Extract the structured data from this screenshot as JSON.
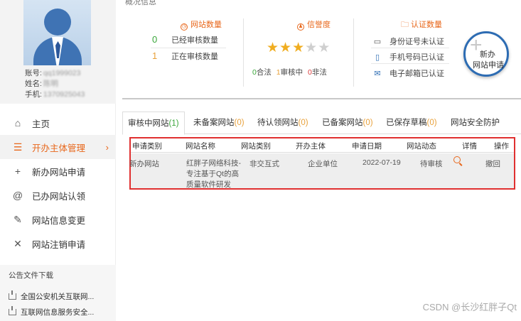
{
  "profile": {
    "account_label": "账号:",
    "account_value": "qq1999023",
    "name_label": "姓名:",
    "name_value": "陈明",
    "phone_label": "手机:",
    "phone_value": "1370925043"
  },
  "nav": {
    "items": [
      {
        "icon": "home-icon",
        "label": "主页"
      },
      {
        "icon": "list-icon",
        "label": "开办主体管理"
      },
      {
        "icon": "plus-icon",
        "label": "新办网站申请"
      },
      {
        "icon": "at-icon",
        "label": "已办网站认领"
      },
      {
        "icon": "edit-icon",
        "label": "网站信息变更"
      },
      {
        "icon": "close-icon",
        "label": "网站注销申请"
      }
    ]
  },
  "notice": {
    "title": "公告文件下载",
    "docs": [
      "全国公安机关互联网...",
      "互联网信息服务安全..."
    ]
  },
  "overview": {
    "title": "概况信息",
    "site_count": {
      "header": "网站数量",
      "reviewed_value": "0",
      "reviewed_label": "已经审核数量",
      "reviewing_value": "1",
      "reviewing_label": "正在审核数量"
    },
    "credit": {
      "header": "信誉度",
      "stars": 3,
      "stars_max": 5,
      "legal_value": "0",
      "legal_label": "合法",
      "review_value": "1",
      "review_label": "审核中",
      "illegal_value": "0",
      "illegal_label": "非法"
    },
    "cert": {
      "header": "认证数量",
      "id_card": "身份证号未认证",
      "phone": "手机号码已认证",
      "email": "电子邮箱已认证"
    },
    "new_site": {
      "line1": "新办",
      "line2": "网站申请"
    }
  },
  "tabs": [
    {
      "label": "审核中网站",
      "count": "(1)"
    },
    {
      "label": "未备案网站",
      "count": "(0)"
    },
    {
      "label": "待认领网站",
      "count": "(0)"
    },
    {
      "label": "已备案网站",
      "count": "(0)"
    },
    {
      "label": "已保存草稿",
      "count": "(0)"
    },
    {
      "label": "网站安全防护",
      "count": ""
    }
  ],
  "table": {
    "headers": [
      "申请类别",
      "网站名称",
      "网站类别",
      "开办主体",
      "申请日期",
      "网站动态",
      "详情",
      "操作"
    ],
    "rows": [
      {
        "category": "新办网站",
        "name": "红胖子网络科技-专注基于Qt的高质量软件研发",
        "type": "非交互式",
        "owner": "企业单位",
        "date": "2022-07-19",
        "status": "待审核",
        "action": "撤回"
      }
    ]
  },
  "watermark": "CSDN @长沙红胖子Qt"
}
